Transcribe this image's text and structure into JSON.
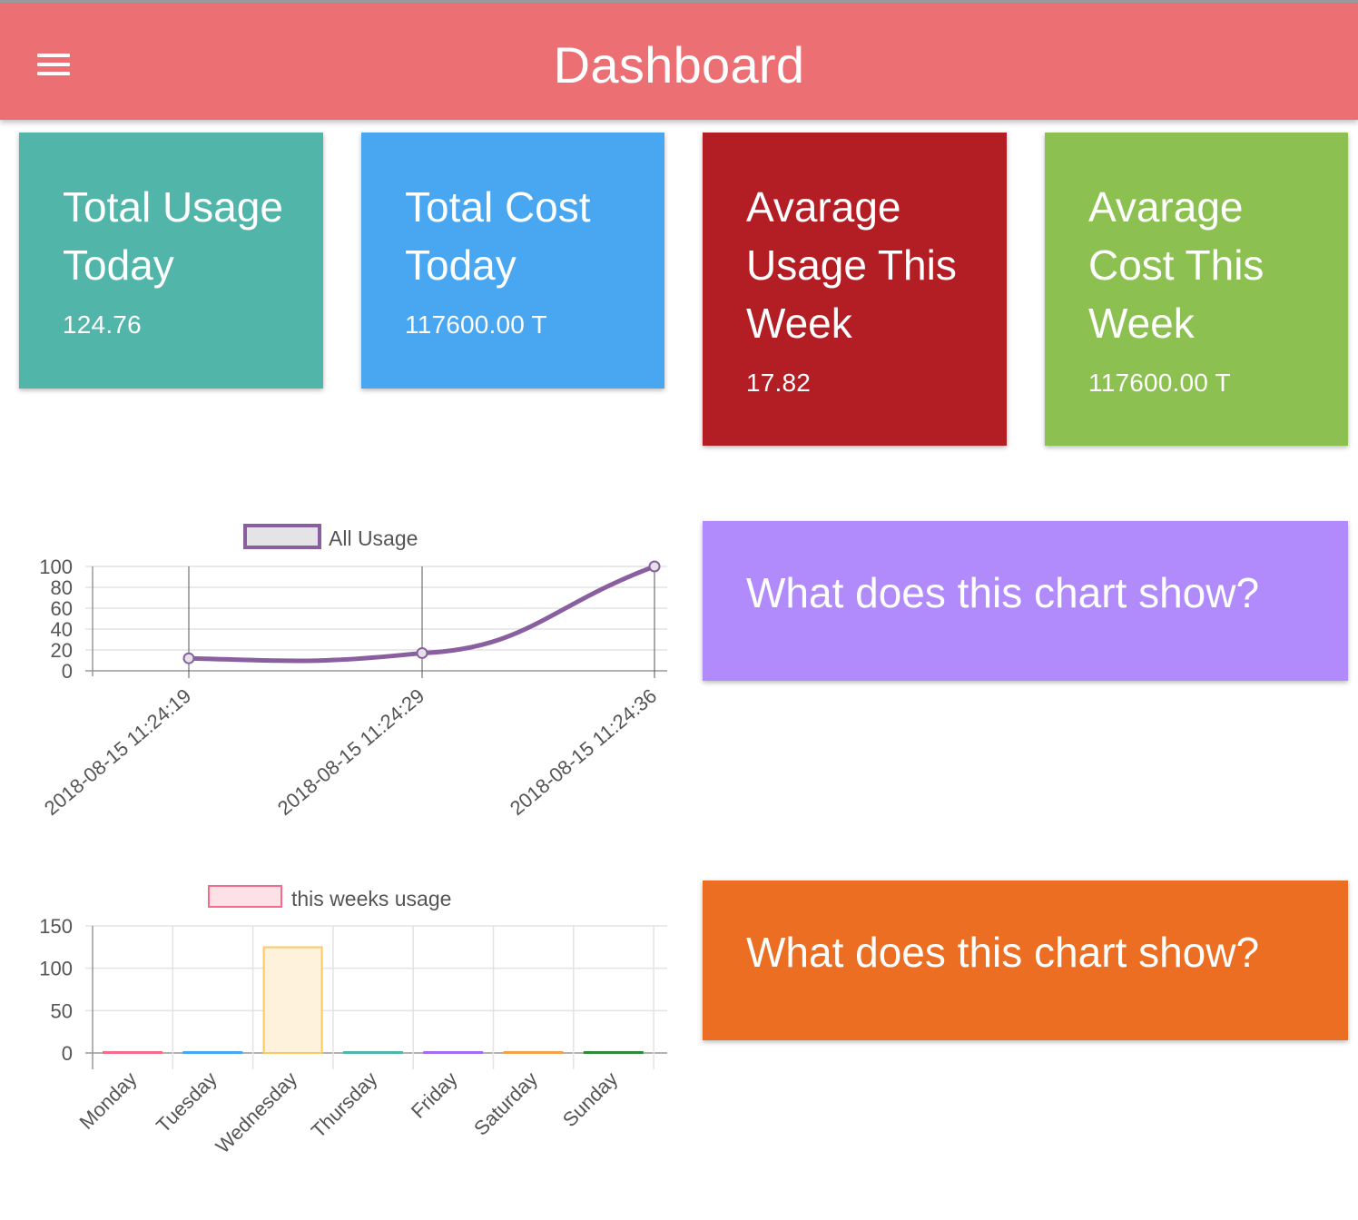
{
  "header": {
    "title": "Dashboard",
    "menu_icon": "hamburger-menu-icon",
    "color": "#ec6f73"
  },
  "cards": [
    {
      "title": "Total Usage Today",
      "value": "124.76",
      "color": "#52b5aa"
    },
    {
      "title": "Total Cost Today",
      "value": "117600.00 T",
      "color": "#49a7f2"
    },
    {
      "title": "Avarage Usage This Week",
      "value": "17.82",
      "color": "#b31e25"
    },
    {
      "title": "Avarage Cost This Week",
      "value": "117600.00 T",
      "color": "#8cc152"
    }
  ],
  "info_cards": [
    {
      "text": "What does this chart show?",
      "color": "#b18bfb"
    },
    {
      "text": "What does this chart show?",
      "color": "#ec6e22"
    }
  ],
  "chart_data": [
    {
      "type": "line",
      "legend": "All Usage",
      "legend_position": "top",
      "x": [
        "2018-08-15 11:24:19",
        "2018-08-15 11:24:29",
        "2018-08-15 11:24:36"
      ],
      "series": [
        {
          "name": "All Usage",
          "values": [
            12,
            17,
            100
          ],
          "color": "#8a5fa0"
        }
      ],
      "ylim": [
        0,
        100
      ],
      "yticks": [
        0,
        20,
        40,
        60,
        80,
        100
      ],
      "grid": true
    },
    {
      "type": "bar",
      "legend": "this weeks usage",
      "legend_position": "top",
      "categories": [
        "Monday",
        "Tuesday",
        "Wednesday",
        "Thursday",
        "Friday",
        "Saturday",
        "Sunday"
      ],
      "series": [
        {
          "name": "this weeks usage",
          "values": [
            0,
            0,
            124.76,
            0,
            0,
            0,
            0
          ]
        }
      ],
      "bar_colors": [
        "#f36c8a",
        "#49a7f2",
        "#fbc961",
        "#52b5aa",
        "#a46cf5",
        "#f5a04a",
        "#2e8b3a"
      ],
      "ylim": [
        0,
        150
      ],
      "yticks": [
        0,
        50,
        100,
        150
      ],
      "grid": true
    }
  ]
}
